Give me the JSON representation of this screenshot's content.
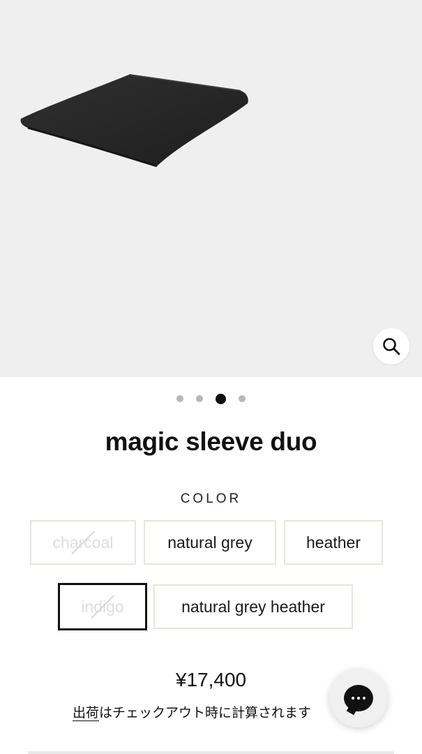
{
  "product": {
    "title": "magic sleeve duo",
    "image_alt": "magic sleeve duo product photo",
    "price": "¥17,400",
    "shipping_note": "出荷はチェックアウト時に計算されます",
    "shipping_link_text": "出荷"
  },
  "gallery": {
    "slide_count": 4,
    "active_slide": 3,
    "zoom_icon": "search-icon"
  },
  "color": {
    "label": "COLOR",
    "options": [
      {
        "label": "charcoal",
        "available": false,
        "selected": false
      },
      {
        "label": "natural grey",
        "available": true,
        "selected": false
      },
      {
        "label": "heather",
        "available": true,
        "selected": false
      },
      {
        "label": "indigo",
        "available": false,
        "selected": true
      },
      {
        "label": "natural grey heather",
        "available": true,
        "selected": false
      }
    ]
  },
  "chat": {
    "icon": "chat-icon"
  },
  "colors": {
    "background": "#ffffff",
    "gallery_bg": "#efefef",
    "text": "#111111",
    "border": "#e6e6dd"
  }
}
